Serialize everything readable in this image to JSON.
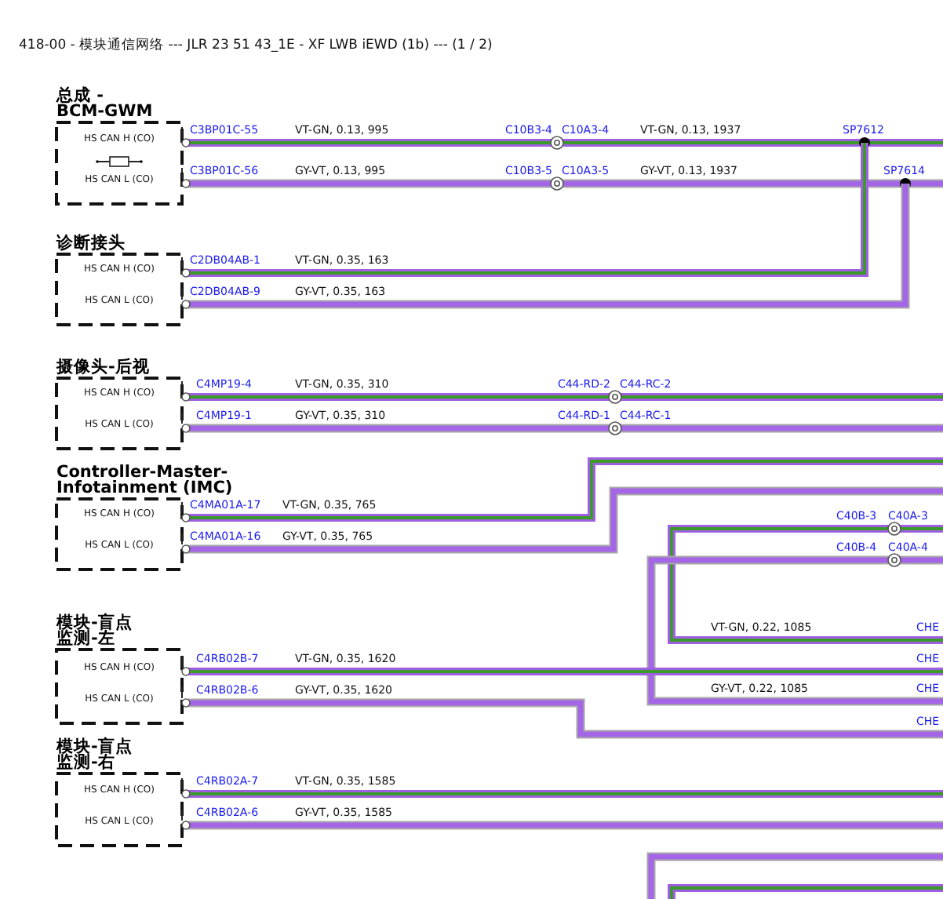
{
  "title": "418-00 - 模块通信网络 --- JLR 23 51 43_1E - XF LWB iEWD (1b) --- (1 / 2)",
  "modules": [
    {
      "title_lines": [
        "总成 -",
        "BCM-GWM"
      ],
      "terminator": true,
      "pins": [
        {
          "kind": "high",
          "label": "HS CAN H (CO)",
          "connector": "C3BP01C-55",
          "wire": "VT-GN, 0.13, 995",
          "inline": {
            "from": "C10B3-4",
            "to": "C10A3-4",
            "wire": "VT-GN, 0.13, 1937"
          },
          "splice": "SP7612"
        },
        {
          "kind": "low",
          "label": "HS CAN L (CO)",
          "connector": "C3BP01C-56",
          "wire": "GY-VT, 0.13, 995",
          "inline": {
            "from": "C10B3-5",
            "to": "C10A3-5",
            "wire": "GY-VT, 0.13, 1937"
          },
          "splice": "SP7614"
        }
      ]
    },
    {
      "title_lines": [
        "诊断接头"
      ],
      "terminator": false,
      "pins": [
        {
          "kind": "high",
          "label": "HS CAN H (CO)",
          "connector": "C2DB04AB-1",
          "wire": "VT-GN, 0.35, 163"
        },
        {
          "kind": "low",
          "label": "HS CAN L (CO)",
          "connector": "C2DB04AB-9",
          "wire": "GY-VT, 0.35, 163"
        }
      ]
    },
    {
      "title_lines": [
        "摄像头-后视"
      ],
      "terminator": false,
      "pins": [
        {
          "kind": "high",
          "label": "HS CAN H (CO)",
          "connector": "C4MP19-4",
          "wire": "VT-GN, 0.35, 310",
          "inline": {
            "from": "C44-RD-2",
            "to": "C44-RC-2"
          }
        },
        {
          "kind": "low",
          "label": "HS CAN L (CO)",
          "connector": "C4MP19-1",
          "wire": "GY-VT, 0.35, 310",
          "inline": {
            "from": "C44-RD-1",
            "to": "C44-RC-1"
          }
        }
      ]
    },
    {
      "title_lines": [
        "Controller-Master-",
        "Infotainment (IMC)"
      ],
      "terminator": false,
      "pins": [
        {
          "kind": "high",
          "label": "HS CAN H (CO)",
          "connector": "C4MA01A-17",
          "wire": "VT-GN, 0.35, 765"
        },
        {
          "kind": "low",
          "label": "HS CAN L (CO)",
          "connector": "C4MA01A-16",
          "wire": "GY-VT, 0.35, 765"
        }
      ]
    },
    {
      "title_lines": [
        "模块-盲点",
        "监测-左"
      ],
      "terminator": false,
      "pins": [
        {
          "kind": "high",
          "label": "HS CAN H (CO)",
          "connector": "C4RB02B-7",
          "wire": "VT-GN, 0.35, 1620",
          "end": "CHE"
        },
        {
          "kind": "low",
          "label": "HS CAN L (CO)",
          "connector": "C4RB02B-6",
          "wire": "GY-VT, 0.35, 1620",
          "end": "CHE"
        }
      ]
    },
    {
      "title_lines": [
        "模块-盲点",
        "监测-右"
      ],
      "terminator": false,
      "pins": [
        {
          "kind": "high",
          "label": "HS CAN H (CO)",
          "connector": "C4RB02A-7",
          "wire": "VT-GN, 0.35, 1585"
        },
        {
          "kind": "low",
          "label": "HS CAN L (CO)",
          "connector": "C4RB02A-6",
          "wire": "GY-VT, 0.35, 1585"
        }
      ]
    }
  ],
  "bus": [
    {
      "kind": "high",
      "inline": {
        "from": "C40B-3",
        "to": "C40A-3"
      },
      "wire": "VT-GN, 0.22, 1085",
      "end": "CHE"
    },
    {
      "kind": "low",
      "inline": {
        "from": "C40B-4",
        "to": "C40A-4"
      },
      "wire": "GY-VT, 0.22, 1085",
      "end": "CHE"
    }
  ]
}
